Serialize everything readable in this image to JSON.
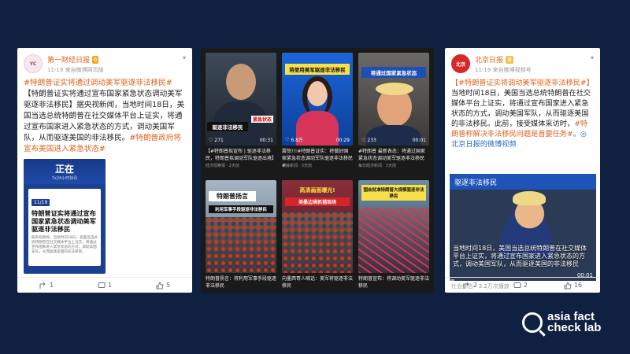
{
  "left_post": {
    "username": "第一财经日报",
    "level": "6",
    "meta": "11-19  来自微博网页版",
    "text_tag": "#特朗普证实将通过调动美军驱逐非法移民#",
    "text_body": "【特朗普证实将通过宣布国家紧急状态调动美军驱逐非法移民】据央视新闻，当地时间18日，美国当选总统特朗普在社交媒体平台上证实，将通过宣布国家进入紧急状态的方式，调动美国军队，从而驱逐美国的非法移民。",
    "text_tag2": "#特朗普政府将宣布美国进入紧急状态#",
    "embed_brand": "正在",
    "embed_brand_sub": "7x24小时快讯",
    "embed_date": "11/19",
    "embed_title": "特朗普证实将通过宣布国家紧急状态调动美军驱逐非法移民",
    "embed_body": "据央视新闻，当地时间18日，美国当选总统特朗普在社交媒体平台上证实，将通过宣布国家进入紧急状态的方式，调动美国军队，从而驱逐美国的非法移民。",
    "reposts": "1",
    "comments": "1",
    "likes": "5"
  },
  "right_post": {
    "username": "北京日报",
    "meta": "11-19  来自微博视频号",
    "text_tag": "【#特朗普证实将调动美军驱逐非法移民#】",
    "text_body": "当地时间18日，美国当选总统特朗普在社交媒体平台上证实，将通过宣布国家进入紧急状态的方式，调动美国军队，从而驱逐美国的非法移民。此前，接受媒体采访时，",
    "text_tag2": "#特朗普称解决非法移民问题是首要任务#",
    "text_link": "。◎北京日报的微博视频",
    "video_banner": "驱逐非法移民",
    "video_subs": "当地时间18日，美国当选总统特朗普在社交媒体平台上证实，将通过宣布国家进入紧急状态的方式，调动美国军队，从而驱逐美国的非法移民",
    "video_time": "00:01",
    "video_meta": "社会综合 · 3.2万次播放",
    "reposts": "2",
    "comments": "2",
    "likes": "16"
  },
  "grid": {
    "tiles": [
      {
        "overlay": "驱逐非法移民",
        "overlay2": "紧急状态",
        "stat": "271",
        "dur": "00:31",
        "caption": "【#特朗普拟宣布 | 驱逐非法移民，特朗普拟调动军队驱逐出境】",
        "source": "经济观察报 · 2天前"
      },
      {
        "overlay": "将使用美军驱逐非法移民",
        "stat": "6.8万",
        "dur": "00:29",
        "caption": "震惊!!!#特朗普证实：将做好国家紧急状态调动军队驱逐非法移民#",
        "source": "动静新闻 · 3天前"
      },
      {
        "overlay": "将通过国家紧急状态",
        "stat": "233",
        "dur": "00:01",
        "caption": "#特朗普 最新表态：将通过国家紧急状态调动美军驱逐非法移民",
        "source": "每日经济新闻 · 3天前"
      },
      {
        "overlay": "特朗普扬言",
        "overlay2": "利用军事手段驱逐非法移民",
        "stat": "",
        "dur": "",
        "caption": "特朗普扬言：将利用军事手段驱逐非法移民",
        "source": ""
      },
      {
        "overlay": "高清画面曝光!",
        "overlay2": "美墨边境抓捕现场",
        "stat": "",
        "dur": "",
        "caption": "向墨西哥人喊话：美军将驱逐非法移民",
        "source": ""
      },
      {
        "overlay": "国会批准特朗普大规模驱逐非法移民",
        "stat": "",
        "dur": "",
        "caption": "特朗普宣布：将调动美军驱逐非法移民",
        "source": ""
      }
    ]
  },
  "logo": {
    "line1": "asia fact",
    "line2": "check lab"
  }
}
